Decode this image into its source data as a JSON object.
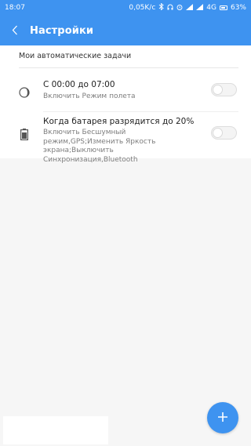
{
  "status_bar": {
    "time": "18:07",
    "speed": "0,05K/c",
    "network": "4G",
    "battery": "63%"
  },
  "app_bar": {
    "title": "Настройки",
    "back_icon": "chevron-left-icon"
  },
  "section": {
    "header": "Мои автоматические задачи"
  },
  "tasks": [
    {
      "icon": "moon-schedule-icon",
      "title": "С 00:00 до 07:00",
      "description": "Включить Режим полета",
      "enabled": false
    },
    {
      "icon": "battery-icon",
      "title": "Когда батарея разрядится до 20%",
      "description": "Включить Бесшумный режим,GPS;Изменить Яркость экрана;Выключить Синхронизация,Bluetooth",
      "enabled": false
    }
  ],
  "fab": {
    "icon": "plus-icon",
    "color": "#3E93F0"
  },
  "colors": {
    "accent": "#3E93F0",
    "background": "#F6F6F6"
  }
}
